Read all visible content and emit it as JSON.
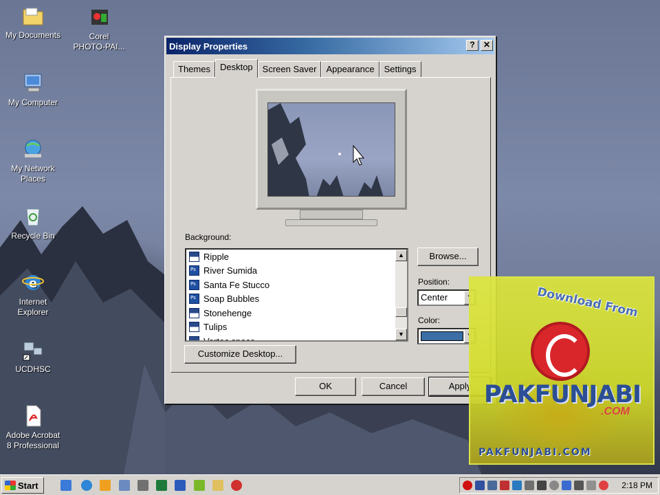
{
  "desktop": {
    "icons": [
      {
        "label_line1": "My Documents",
        "label_line2": "",
        "icon": "folder-icon"
      },
      {
        "label_line1": "Corel",
        "label_line2": "PHOTO-PAI...",
        "icon": "corel-photo-paint-icon"
      },
      {
        "label_line1": "My Computer",
        "label_line2": "",
        "icon": "computer-icon"
      },
      {
        "label_line1": "My Network",
        "label_line2": "Places",
        "icon": "network-icon"
      },
      {
        "label_line1": "Recycle Bin",
        "label_line2": "",
        "icon": "recycle-bin-icon"
      },
      {
        "label_line1": "Internet",
        "label_line2": "Explorer",
        "icon": "internet-explorer-icon"
      },
      {
        "label_line1": "UCDHSC",
        "label_line2": "",
        "icon": "network-shortcut-icon"
      },
      {
        "label_line1": "Adobe Acrobat",
        "label_line2": "8 Professional",
        "icon": "acrobat-icon"
      }
    ]
  },
  "dialog": {
    "title": "Display Properties",
    "help_label": "?",
    "close_label": "✕",
    "tabs": [
      "Themes",
      "Desktop",
      "Screen Saver",
      "Appearance",
      "Settings"
    ],
    "active_tab": "Desktop",
    "background_label": "Background:",
    "background_items": [
      {
        "name": "Ripple",
        "icon": "image-icon"
      },
      {
        "name": "River Sumida",
        "icon": "photoshop-file-icon"
      },
      {
        "name": "Santa Fe Stucco",
        "icon": "photoshop-file-icon"
      },
      {
        "name": "Soap Bubbles",
        "icon": "photoshop-file-icon"
      },
      {
        "name": "Stonehenge",
        "icon": "image-icon"
      },
      {
        "name": "Tulips",
        "icon": "image-icon"
      },
      {
        "name": "Vortec space",
        "icon": "image-icon"
      }
    ],
    "browse_label": "Browse...",
    "position_label": "Position:",
    "position_value": "Center",
    "color_label": "Color:",
    "color_value": "#3a6ea5",
    "customize_label": "Customize Desktop...",
    "ok_label": "OK",
    "cancel_label": "Cancel",
    "apply_label": "Apply"
  },
  "watermark": {
    "top_text": "Download From",
    "brand": "PAKFUNJABI",
    "brand_suffix": ".COM",
    "bottom_text": "PAKFUNJABI.COM"
  },
  "taskbar": {
    "start_label": "Start",
    "clock": "2:18 PM"
  }
}
